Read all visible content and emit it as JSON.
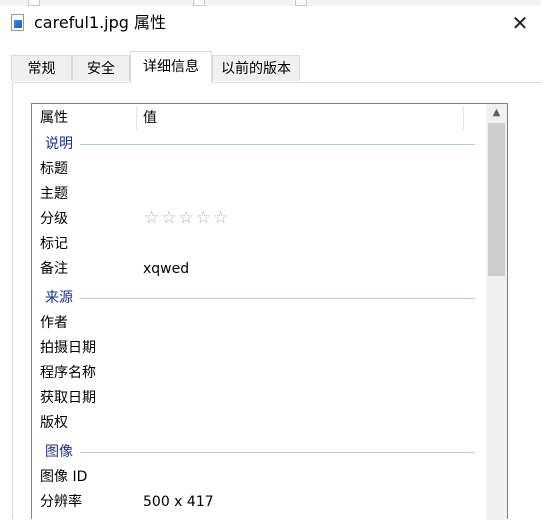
{
  "window": {
    "title": "careful1.jpg 属性",
    "close_symbol": "✕"
  },
  "tabs": [
    {
      "label": "常规",
      "active": false
    },
    {
      "label": "安全",
      "active": false
    },
    {
      "label": "详细信息",
      "active": true
    },
    {
      "label": "以前的版本",
      "active": false
    }
  ],
  "columns": {
    "property": "属性",
    "value": "值"
  },
  "groups": {
    "description": "说明",
    "origin": "来源",
    "image": "图像"
  },
  "description_rows": [
    {
      "key": "标题",
      "value": ""
    },
    {
      "key": "主题",
      "value": ""
    },
    {
      "key": "分级",
      "value": ""
    },
    {
      "key": "标记",
      "value": ""
    },
    {
      "key": "备注",
      "value": "xqwed"
    }
  ],
  "rating": {
    "stars_total": 5,
    "stars_filled": 0,
    "glyphs": "☆☆☆☆☆"
  },
  "origin_rows": [
    {
      "key": "作者",
      "value": ""
    },
    {
      "key": "拍摄日期",
      "value": ""
    },
    {
      "key": "程序名称",
      "value": ""
    },
    {
      "key": "获取日期",
      "value": ""
    },
    {
      "key": "版权",
      "value": ""
    }
  ],
  "image_rows": [
    {
      "key": "图像 ID",
      "value": ""
    },
    {
      "key": "分辨率",
      "value": "500 x 417"
    }
  ],
  "icons": {
    "file": "jpg-file-icon",
    "scroll_up": "scroll-up-arrow-icon"
  }
}
